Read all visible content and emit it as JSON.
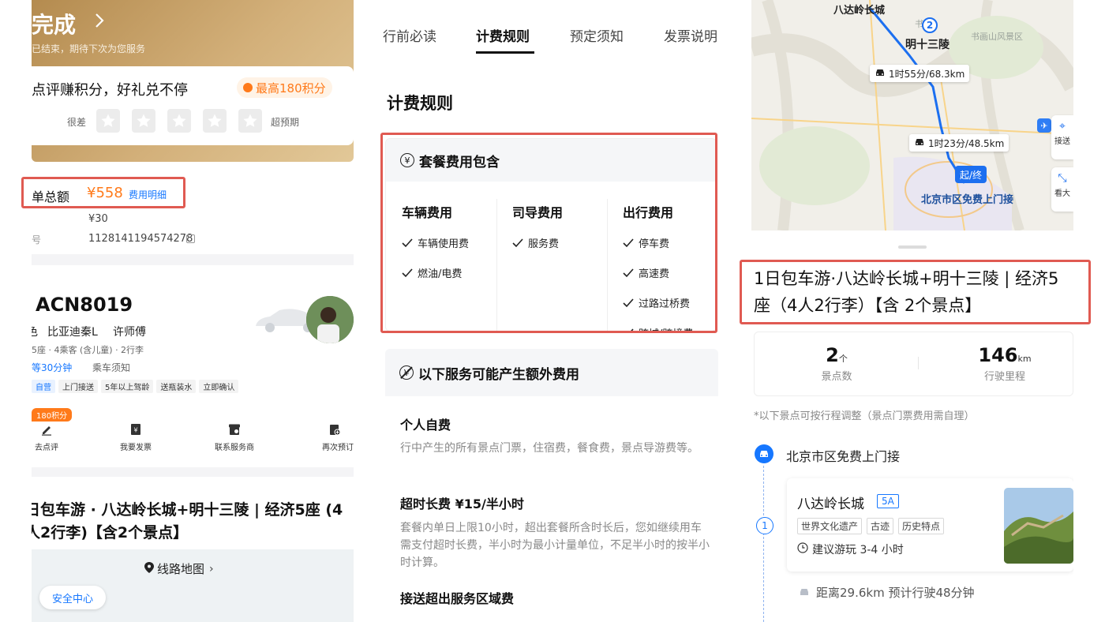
{
  "colors": {
    "accent": "#ff7a1a",
    "brand_blue": "#1677ff",
    "highlight_box": "#e05a52",
    "gold": "#c9a067"
  },
  "left": {
    "header_title": "完成",
    "header_chevron": "chevron-right-icon",
    "header_sub": "已结束，期待下次为您服务",
    "review": {
      "title": "点评赚积分，好礼兑不停",
      "points_badge": "最高180积分",
      "label_bad": "很差",
      "label_good": "超预期",
      "rating": {
        "value": 0,
        "max": 5
      }
    },
    "order_total": {
      "label": "单总额",
      "amount": "¥558",
      "detail_link": "费用明细"
    },
    "row1": {
      "label": "",
      "value": "¥30"
    },
    "row2": {
      "label": "号",
      "value": "1128141194574278"
    },
    "driver": {
      "plate": "ACN8019",
      "car": "比亚迪秦L",
      "driver_name": "许师傅",
      "car_prefix": "色",
      "seats": "5座 · 4乘客 (含儿童) · 2行李",
      "wait_prefix": "等30分钟",
      "notice_link": "乘车须知",
      "tags": [
        "自营",
        "上门接送",
        "5年以上驾龄",
        "送瓶装水",
        "立即确认"
      ]
    },
    "points_badge": "180积分",
    "actions": [
      "去点评",
      "我要发票",
      "联系服务商",
      "再次预订"
    ],
    "trip_title": "日包车游 · 八达岭长城+明十三陵 | 经济5座 (4人2行李)【含2个景点】",
    "route_btn": "线路地图",
    "safety": "安全中心"
  },
  "middle": {
    "tabs": [
      "行前必读",
      "计费规则",
      "预定须知",
      "发票说明"
    ],
    "active_tab": 1,
    "section_title": "计费规则",
    "package": {
      "title": "套餐费用包含",
      "columns": [
        {
          "title": "车辆费用",
          "items": [
            "车辆使用费",
            "燃油/电费"
          ]
        },
        {
          "title": "司导费用",
          "items": [
            "服务费"
          ]
        },
        {
          "title": "出行费用",
          "items": [
            "停车费",
            "高速费",
            "过路过桥费",
            "跨城/跨境费"
          ]
        }
      ]
    },
    "extra": {
      "title": "以下服务可能产生额外费用"
    },
    "blocks": [
      {
        "title": "个人自费",
        "text": "行中产生的所有景点门票，住宿费，餐食费，景点导游费等。"
      },
      {
        "title": "超时长费 ¥15/半小时",
        "text": "套餐内单日上限10小时，超出套餐所含时长后，您如继续用车需支付超时长费，半小时为最小计量单位，不足半小时的按半小时计算。"
      },
      {
        "title": "接送超出服务区域费",
        "text": ""
      }
    ]
  },
  "right": {
    "map": {
      "label_badaling": "八达岭长城",
      "label_ming": "明十三陵",
      "marker_2": "2",
      "seg1": "1时55分/68.3km",
      "seg2": "1时23分/48.5km",
      "start_end": "起/终",
      "city_label": "北京市区免费上门接",
      "side_btn1": "接送",
      "side_btn2": "看大",
      "bg_label1": "书画",
      "bg_label2": "书画山风景区"
    },
    "title": "1日包车游·八达岭长城+明十三陵 | 经济5座（4人2行李）【含 2个景点】",
    "stats": [
      {
        "value": "2",
        "unit": "个",
        "label": "景点数"
      },
      {
        "value": "146",
        "unit": "km",
        "label": "行驶里程"
      }
    ],
    "note": "*以下景点可按行程调整（景点门票费用需自理）",
    "pickup": "北京市区免费上门接",
    "spot": {
      "index": "1",
      "name": "八达岭长城",
      "level": "5A",
      "tags": [
        "世界文化遗产",
        "古迹",
        "历史特点"
      ],
      "suggest": "建议游玩 3-4 小时"
    },
    "distance": "距离29.6km 预计行驶48分钟"
  }
}
